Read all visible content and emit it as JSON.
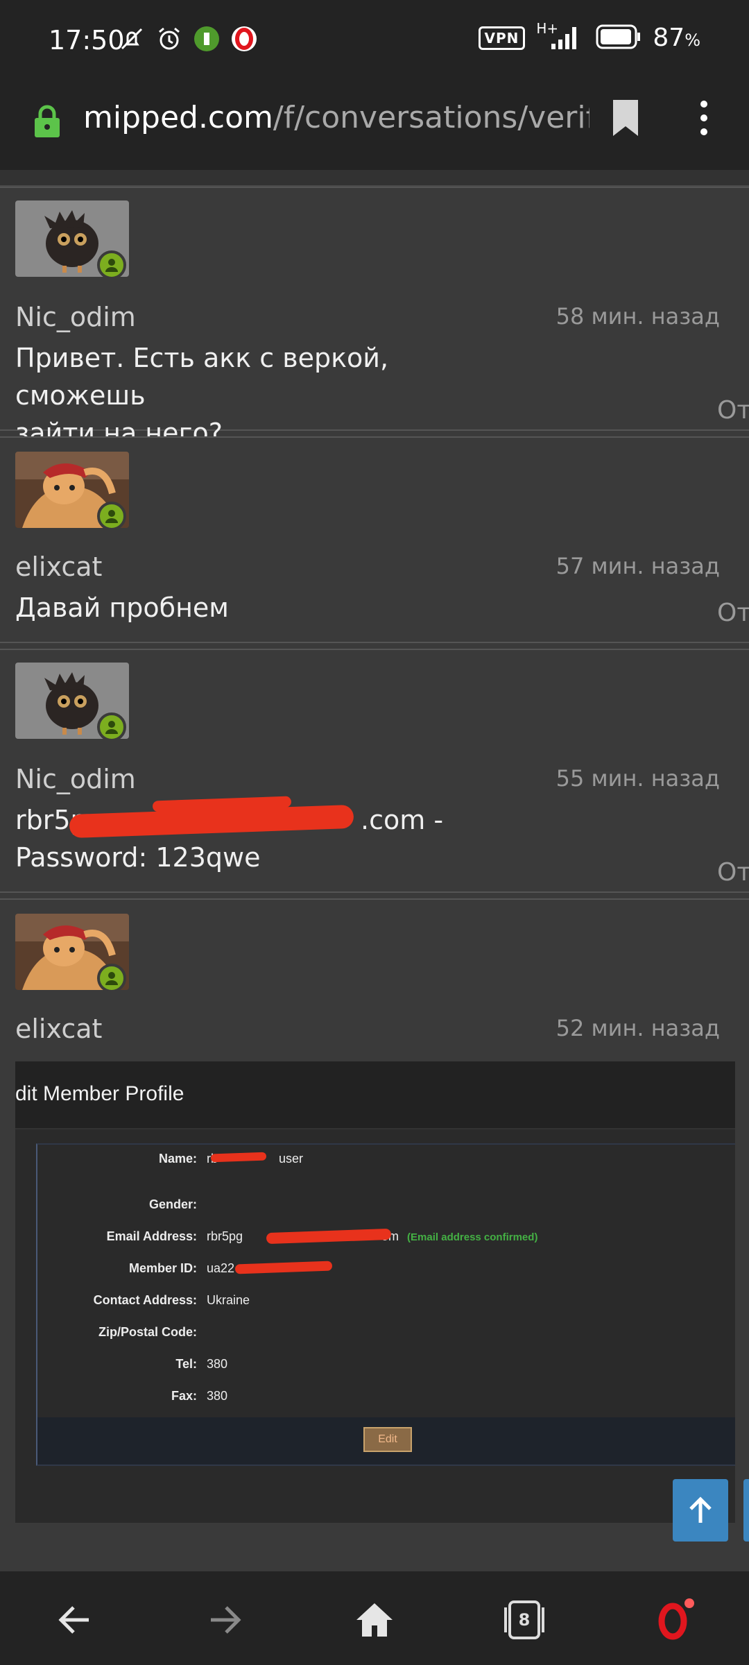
{
  "status_bar": {
    "time": "17:50",
    "network": "H+",
    "vpn": "VPN",
    "battery": "87",
    "battery_unit": "%"
  },
  "address_bar": {
    "host": "mipped.com",
    "path": "/f/conversations/verifika"
  },
  "messages": [
    {
      "username": "Nic_odim",
      "time": "58 мин. назад",
      "text_lines": [
        "Привет. Есть акк с веркой, сможешь",
        "зайти на него?"
      ],
      "side_label": "От",
      "avatar": "owl-avatar"
    },
    {
      "username": "elixcat",
      "time": "57 мин. назад",
      "text_lines": [
        "Давай пробнем"
      ],
      "side_label": "От",
      "avatar": "cat-avatar"
    },
    {
      "username": "Nic_odim",
      "time": "55 мин. назад",
      "text_lines": [
        "rbr5p",
        ".com -",
        "Password: 123qwe"
      ],
      "side_label": "От",
      "avatar": "owl-avatar"
    },
    {
      "username": "elixcat",
      "time": "52 мин. назад",
      "avatar": "cat-avatar"
    }
  ],
  "embedded_screenshot": {
    "title": "dit Member Profile",
    "fields": [
      {
        "label": "Name:",
        "value": "rb",
        "value_tail": "user"
      },
      {
        "label": "Gender:",
        "value": ""
      },
      {
        "label": "Email Address:",
        "value": "rbr5pg",
        "value_tail": "om",
        "note": "(Email address confirmed)"
      },
      {
        "label": "Member ID:",
        "value": "ua22",
        "value_tail": ""
      },
      {
        "label": "Contact Address:",
        "value": "Ukraine"
      },
      {
        "label": "Zip/Postal Code:",
        "value": ""
      },
      {
        "label": "Tel:",
        "value": "380"
      },
      {
        "label": "Fax:",
        "value": "380"
      }
    ],
    "edit_button": "Edit"
  },
  "bottom_nav": {
    "tabs_count": "8"
  },
  "colors": {
    "online": "#7cae1f",
    "scroll_top": "#3b86c0",
    "lock": "#5cc34a",
    "opera": "#e0161e"
  }
}
